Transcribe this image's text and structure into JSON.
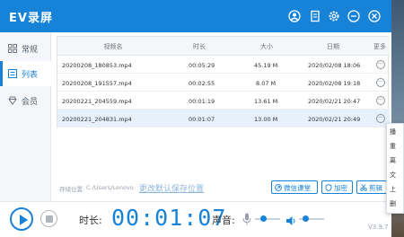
{
  "window": {
    "title": "EV录屏"
  },
  "titlebar_icons": [
    "user-icon",
    "document-icon",
    "gear-icon",
    "minimize-icon",
    "close-icon"
  ],
  "sidebar": {
    "items": [
      {
        "label": "常规",
        "icon": "grid-icon",
        "active": false
      },
      {
        "label": "列表",
        "icon": "list-icon",
        "active": true
      },
      {
        "label": "会员",
        "icon": "diamond-icon",
        "active": false
      }
    ]
  },
  "table": {
    "headers": {
      "name": "视频名",
      "duration": "时长",
      "size": "大小",
      "date": "日期",
      "more": "更多"
    },
    "rows": [
      {
        "name": "20200208_180853.mp4",
        "duration": "00:05:29",
        "size": "45.19 M",
        "date": "2020/02/08 18:06",
        "more": "···"
      },
      {
        "name": "20200208_191557.mp4",
        "duration": "00:02:55",
        "size": "8.07 M",
        "date": "2020/02/08 19:18",
        "more": "···"
      },
      {
        "name": "20200221_204559.mp4",
        "duration": "00:01:19",
        "size": "13.61 M",
        "date": "2020/02/21 20:47",
        "more": "···"
      },
      {
        "name": "20200221_204831.mp4",
        "duration": "00:01:07",
        "size": "13.00 M",
        "date": "2020/02/21 20:49",
        "more": "···"
      }
    ]
  },
  "footer": {
    "path_label": "存储位置:",
    "path_value": "C:/Users/Lenovo",
    "change_path_link": "更改默认保存位置",
    "buttons": {
      "wechat": "微信课堂",
      "encrypt": "加密",
      "cut": "剪辑"
    }
  },
  "recorder": {
    "duration_label": "时长:",
    "timer": "00:01:07",
    "volume_label": "声音:",
    "mic_level": 0.3,
    "speaker_level": 0.2,
    "version": "V3.9.7"
  },
  "context_menu": {
    "items": [
      "播",
      "重",
      "离",
      "文",
      "上",
      "删"
    ]
  },
  "colors": {
    "accent": "#1783d8",
    "sidebar_bg": "#f4f6f9",
    "selected_row": "#e6f1fc"
  }
}
